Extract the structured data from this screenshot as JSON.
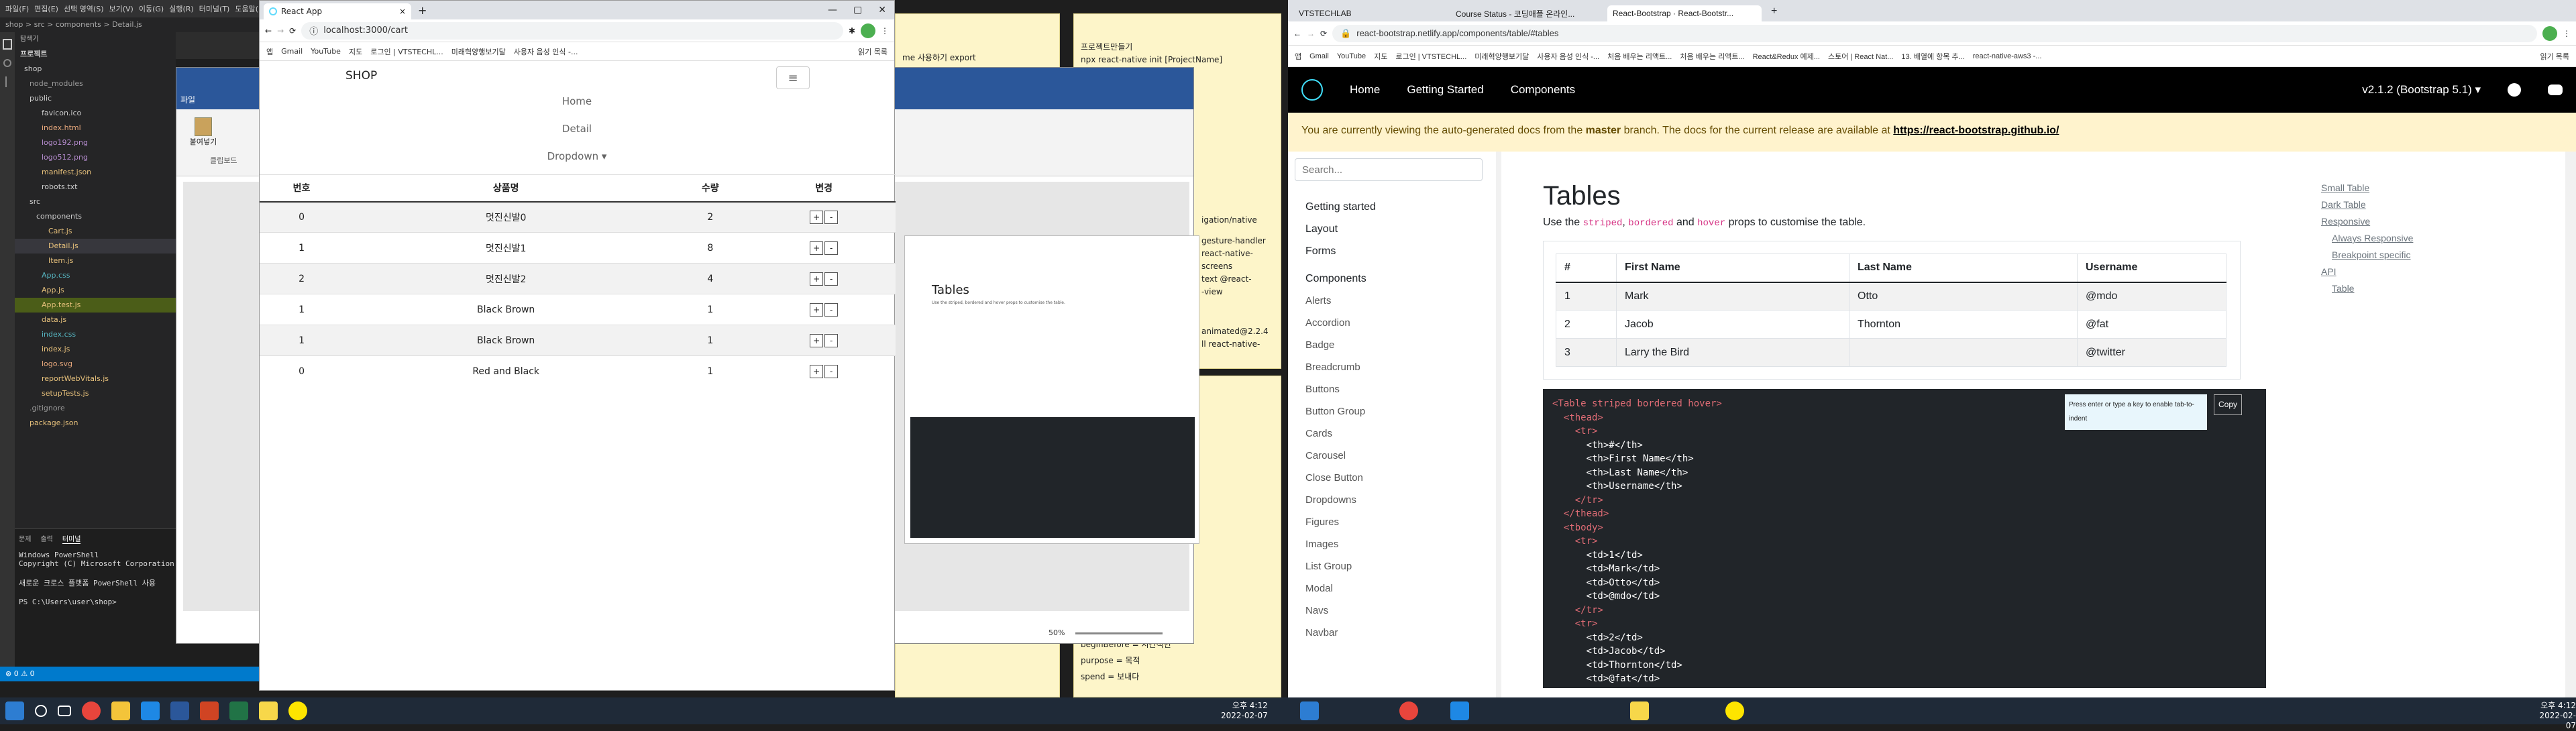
{
  "vscode": {
    "menu": [
      "파일(F)",
      "편집(E)",
      "선택 영역(S)",
      "보기(V)",
      "이동(G)",
      "실행(R)",
      "터미널(T)",
      "도움말(H)"
    ],
    "path": "shop > src > components > Detail.js",
    "explorer_title": "탐색기",
    "section": "프로젝트",
    "tree": [
      "shop",
      "node_modules",
      "public",
      "favicon.ico",
      "index.html",
      "logo192.png",
      "logo512.png",
      "manifest.json",
      "robots.txt",
      "src",
      "components",
      "Cart.js",
      "Detail.js",
      "Item.js",
      "App.css",
      "App.js",
      "App.test.js",
      "data.js",
      "index.css",
      "index.js",
      "logo.svg",
      "reportWebVitals.js",
      "setupTests.js",
      ".gitignore",
      "package.json"
    ],
    "terminal_tabs": [
      "문제",
      "출력",
      "터미널"
    ],
    "terminal_lines": [
      "Windows PowerShell",
      "Copyright (C) Microsoft Corporation.",
      "",
      "새로운 크로스 플랫폼 PowerShell 사용",
      "",
      "PS C:\\Users\\user\\shop>"
    ],
    "status": "⊗ 0  ⚠ 0"
  },
  "notepad_left": {
    "lines": [
      "me 사용하기 export"
    ]
  },
  "notepad_mid": {
    "lines": [
      "프로젝트만들기",
      "npx react-native init [ProjectName]",
      "",
      "",
      "",
      "",
      "",
      "",
      "",
      "",
      "",
      "",
      "",
      "igation/native",
      "",
      "gesture-handler",
      "react-native-screens",
      "text @react-",
      "-view",
      "",
      "",
      "",
      "animated@2.2.4",
      "ll react-native-"
    ]
  },
  "notepad_bottom": {
    "lines": [
      "beginBefore = 시간적인",
      "purpose = 목적",
      "spend = 보내다"
    ]
  },
  "chrome_main": {
    "tab_title": "React App",
    "url": "localhost:3000/cart",
    "bookmarks": [
      "앱",
      "Gmail",
      "YouTube",
      "지도",
      "로그인 | VTSTECHL...",
      "미래혁양행보기달",
      "사용자 음성 인식 -...",
      "읽기 목록"
    ],
    "brand": "SHOP",
    "nav": [
      "Home",
      "Detail",
      "Dropdown ▾"
    ],
    "table_headers": [
      "번호",
      "상품명",
      "수량",
      "변경"
    ],
    "rows": [
      {
        "id": "0",
        "name": "멋진신발0",
        "qty": "2"
      },
      {
        "id": "1",
        "name": "멋진신발1",
        "qty": "8"
      },
      {
        "id": "2",
        "name": "멋진신발2",
        "qty": "4"
      },
      {
        "id": "1",
        "name": "Black Brown",
        "qty": "1"
      },
      {
        "id": "1",
        "name": "Black Brown",
        "qty": "1"
      },
      {
        "id": "0",
        "name": "Red and Black",
        "qty": "1"
      }
    ],
    "plus": "+",
    "minus": "-"
  },
  "word": {
    "ribbon_tab": "파일",
    "paste": "붙여넣기",
    "clipboard": "클립보드",
    "zoom": "50%",
    "mini_title": "Tables",
    "mini_sub": "Use the striped, bordered and hover props to customise the table."
  },
  "chrome_rb": {
    "tabs": [
      "VTSTECHLAB",
      "Course Status - 코딩애플 온라인...",
      "React-Bootstrap · React-Bootstr..."
    ],
    "url": "react-bootstrap.netlify.app/components/table/#tables",
    "bookmarks": [
      "앱",
      "Gmail",
      "YouTube",
      "지도",
      "로그인 | VTSTECHL...",
      "미래혁양행보기달",
      "사용자 음성 인식 -...",
      "처음 배우는 리액트...",
      "처음 배우는 리액트...",
      "React&Redux 예제...",
      "스토어 | React Nat...",
      "13. 배열에 항목 추...",
      "react-native-aws3 -...",
      "읽기 목록"
    ],
    "nav": [
      "Home",
      "Getting Started",
      "Components"
    ],
    "version": "v2.1.2 (Bootstrap 5.1) ▾",
    "banner_pre": "You are currently viewing the auto-generated docs from the ",
    "banner_bold": "master",
    "banner_mid": " branch. The docs for the current release are available at ",
    "banner_link": "https://react-bootstrap.github.io/",
    "search_placeholder": "Search...",
    "sidebar": [
      "Getting started",
      "Layout",
      "Forms",
      "Components",
      "Alerts",
      "Accordion",
      "Badge",
      "Breadcrumb",
      "Buttons",
      "Button Group",
      "Cards",
      "Carousel",
      "Close Button",
      "Dropdowns",
      "Figures",
      "Images",
      "List Group",
      "Modal",
      "Navs",
      "Navbar"
    ],
    "heading": "Tables",
    "lead_pre": "Use the ",
    "lead_k1": "striped",
    "lead_c1": ", ",
    "lead_k2": "bordered",
    "lead_c2": " and ",
    "lead_k3": "hover",
    "lead_post": " props to customise the table.",
    "table_headers": [
      "#",
      "First Name",
      "Last Name",
      "Username"
    ],
    "table_rows": [
      [
        "1",
        "Mark",
        "Otto",
        "@mdo"
      ],
      [
        "2",
        "Jacob",
        "Thornton",
        "@fat"
      ],
      [
        "3",
        "Larry the Bird",
        "",
        "@twitter"
      ]
    ],
    "code_hint": "Press enter or type a key to enable tab-to-indent",
    "copy": "Copy",
    "code_lines": [
      "<Table striped bordered hover>",
      "  <thead>",
      "    <tr>",
      "      <th>#</th>",
      "      <th>First Name</th>",
      "      <th>Last Name</th>",
      "      <th>Username</th>",
      "    </tr>",
      "  </thead>",
      "  <tbody>",
      "    <tr>",
      "      <td>1</td>",
      "      <td>Mark</td>",
      "      <td>Otto</td>",
      "      <td>@mdo</td>",
      "    </tr>",
      "    <tr>",
      "      <td>2</td>",
      "      <td>Jacob</td>",
      "      <td>Thornton</td>",
      "      <td>@fat</td>"
    ],
    "toc": [
      "Small Table",
      "Dark Table",
      "Responsive",
      "Always Responsive",
      "Breakpoint specific",
      "API",
      "Table"
    ]
  },
  "taskbar": {
    "time_left": "오후 4:12",
    "date_left": "2022-02-07",
    "time_right": "오후 4:12",
    "date_right": "2022-02-07"
  }
}
